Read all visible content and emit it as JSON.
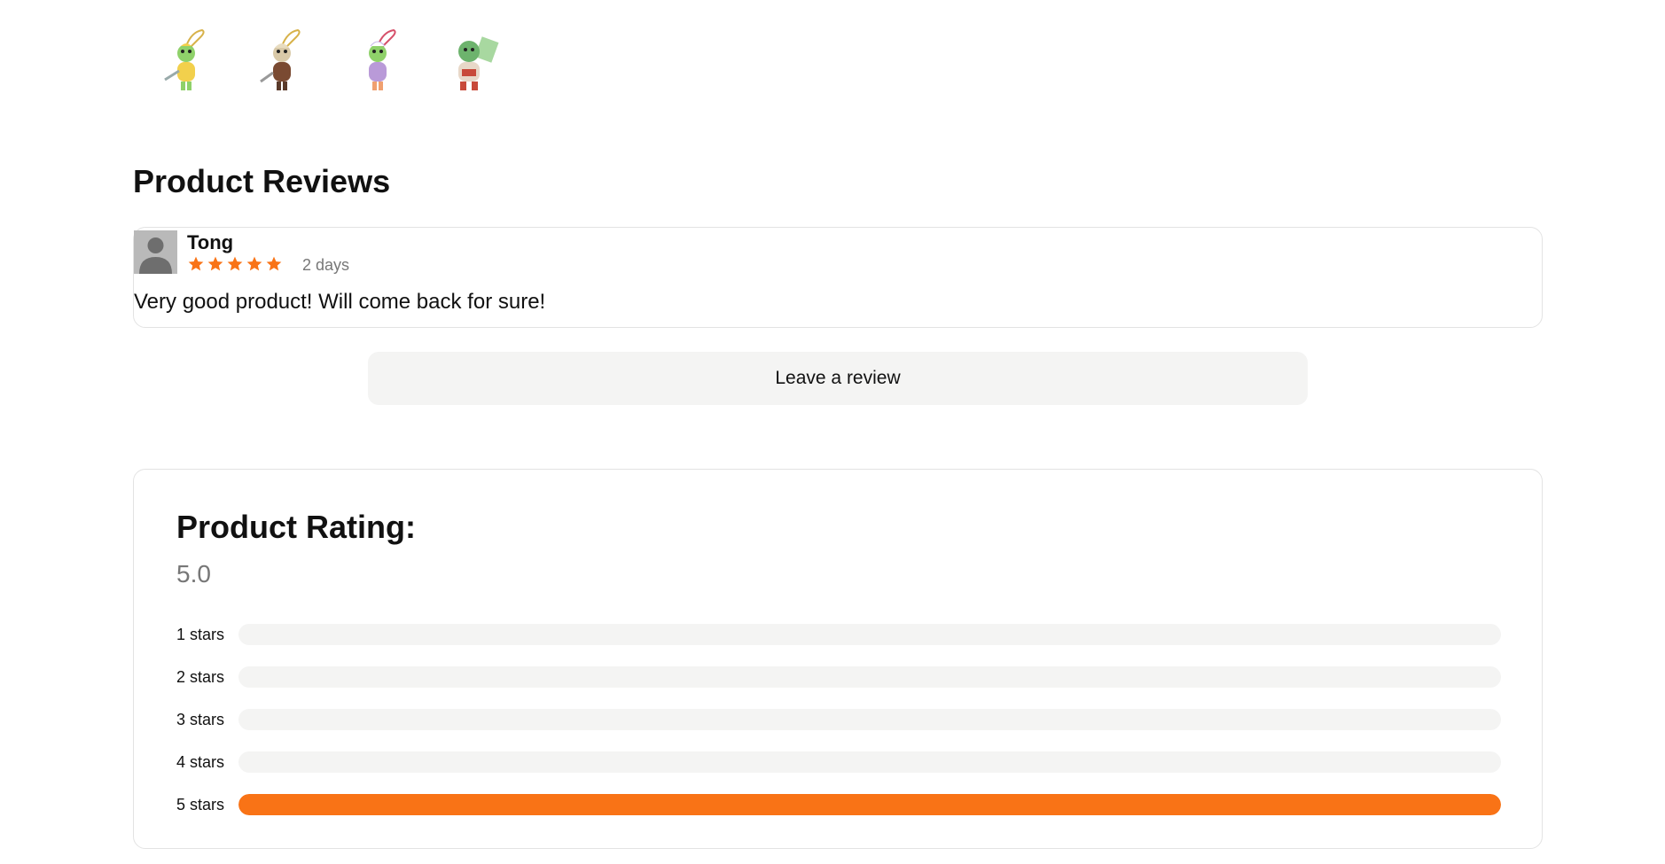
{
  "thumbnails": [
    {
      "icon": "plush-keychain-yellow-icon",
      "color": "#f2d04c"
    },
    {
      "icon": "plush-keychain-brown-icon",
      "color": "#7a4a32"
    },
    {
      "icon": "plush-keychain-purple-icon",
      "color": "#b99ad8"
    },
    {
      "icon": "plush-keychain-green-icon",
      "color": "#6db36d"
    }
  ],
  "reviews_section": {
    "title": "Product Reviews",
    "reviews": [
      {
        "name": "Tong",
        "stars": 5,
        "date": "2 days",
        "text": "Very good product! Will come back for sure!"
      }
    ],
    "leave_review_label": "Leave a review"
  },
  "rating_section": {
    "title": "Product Rating:",
    "average": "5.0",
    "rows": [
      {
        "label": "1 stars",
        "fraction": 0
      },
      {
        "label": "2 stars",
        "fraction": 0
      },
      {
        "label": "3 stars",
        "fraction": 0
      },
      {
        "label": "4 stars",
        "fraction": 0
      },
      {
        "label": "5 stars",
        "fraction": 1
      }
    ]
  },
  "colors": {
    "accent": "#f97316",
    "track": "#f4f4f3",
    "muted_text": "#777777",
    "avatar_bg": "#b9b9b9"
  }
}
